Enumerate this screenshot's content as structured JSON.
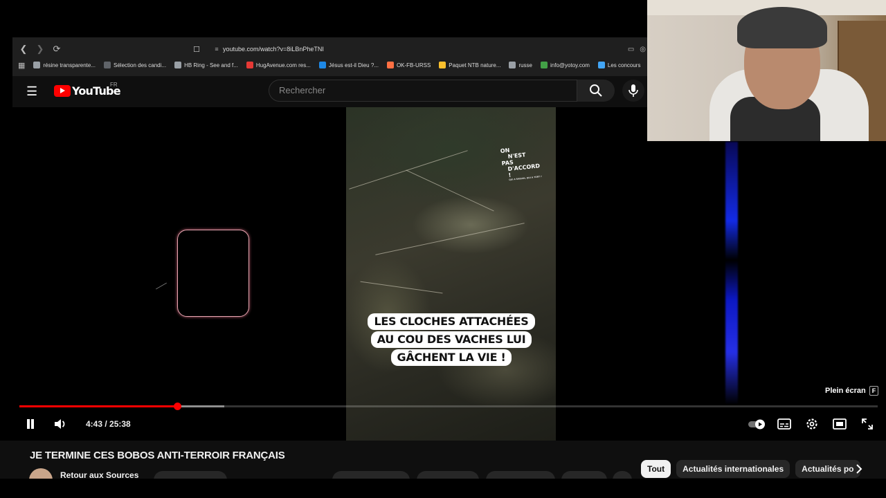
{
  "browser": {
    "url": "youtube.com/watch?v=8iLBnPheTNI",
    "bookmarks": [
      {
        "label": "résine transparente...",
        "color": "#9aa0a6"
      },
      {
        "label": "Sélection des candi...",
        "color": "#5f6368"
      },
      {
        "label": "HB Ring - See and f...",
        "color": "#9aa0a6"
      },
      {
        "label": "HugAvenue.com res...",
        "color": "#e53935"
      },
      {
        "label": "Jésus est-il Dieu ?...",
        "color": "#1e88e5"
      },
      {
        "label": "OK-FB-URSS",
        "color": "#ff7043"
      },
      {
        "label": "Paquet NTB nature...",
        "color": "#fbc02d"
      },
      {
        "label": "russe",
        "color": "#9aa0a6"
      },
      {
        "label": "info@yotoy.com",
        "color": "#43a047"
      },
      {
        "label": "Les concours",
        "color": "#42a5f5"
      }
    ]
  },
  "masthead": {
    "logo_text": "YouTube",
    "region": "FR",
    "search_placeholder": "Rechercher"
  },
  "video": {
    "caption_lines": [
      "LES CLOCHES ATTACHÉES",
      "AU COU DES VACHES LUI",
      "GÂCHENT LA VIE !"
    ],
    "brand_lines": [
      "ON",
      "N'EST",
      "PAS",
      "D'ACCORD !"
    ],
    "brand_tagline": "QUI A RAISON, QUI A TORT ?"
  },
  "player": {
    "time": "4:43 / 25:38",
    "played_fraction": 0.184,
    "buffered_fraction": 0.239,
    "fullscreen_tooltip": "Plein écran",
    "fullscreen_key": "F"
  },
  "below": {
    "title": "JE TERMINE CES BOBOS ANTI-TERROIR FRANÇAIS",
    "channel": "Retour aux Sources",
    "chips": [
      "Tout",
      "Actualités internationales",
      "Actualités po"
    ]
  }
}
